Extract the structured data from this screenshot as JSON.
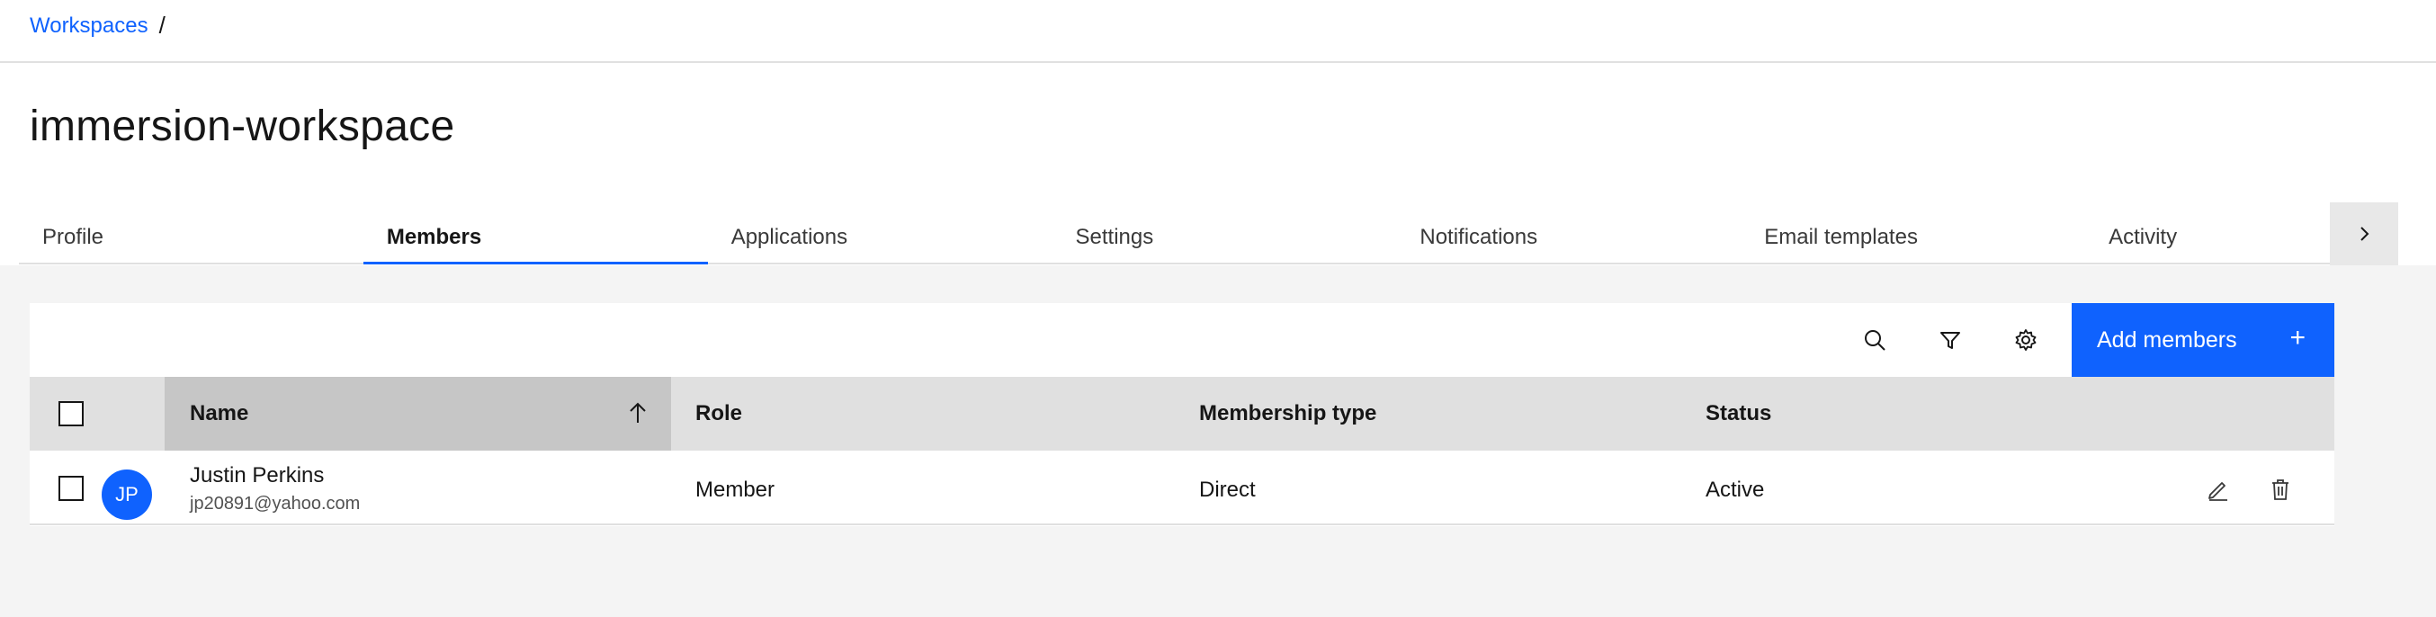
{
  "breadcrumb": {
    "link": "Workspaces",
    "separator": "/"
  },
  "page": {
    "title": "immersion-workspace"
  },
  "tabs": [
    {
      "label": "Profile"
    },
    {
      "label": "Members",
      "active": true
    },
    {
      "label": "Applications"
    },
    {
      "label": "Settings"
    },
    {
      "label": "Notifications"
    },
    {
      "label": "Email templates"
    },
    {
      "label": "Activity"
    }
  ],
  "icons": {
    "tab_next": "chevron-right-icon",
    "search": "search-icon",
    "filter": "filter-icon",
    "settings": "gear-icon",
    "sort": "arrow-up-icon",
    "edit": "pencil-icon",
    "delete": "trash-icon"
  },
  "toolbar": {
    "add_label": "Add members",
    "add_icon": "+"
  },
  "table": {
    "columns": {
      "name": "Name",
      "role": "Role",
      "membership": "Membership type",
      "status": "Status"
    },
    "rows": [
      {
        "initials": "JP",
        "name": "Justin Perkins",
        "email": "jp20891@yahoo.com",
        "role": "Member",
        "membership": "Direct",
        "status": "Active"
      }
    ]
  },
  "colors": {
    "accent": "#0f62fe",
    "header_bg": "#e0e0e0",
    "sorted_header_bg": "#c6c6c6",
    "page_bg": "#f4f4f4"
  }
}
